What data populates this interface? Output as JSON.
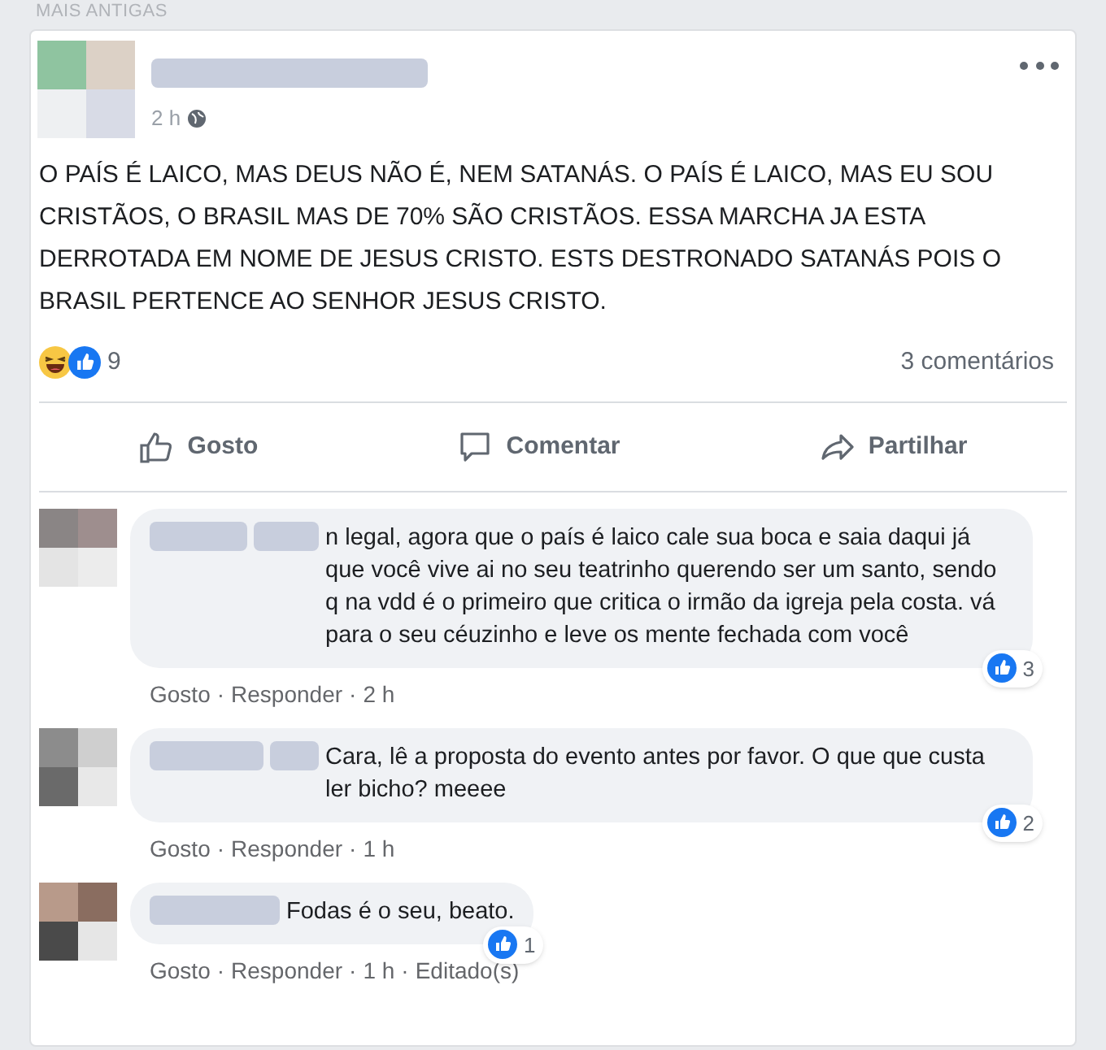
{
  "section_label": "MAIS ANTIGAS",
  "post": {
    "time": "2 h",
    "text": "O PAÍS É LAICO, MAS DEUS NÃO É, NEM SATANÁS. O PAÍS É LAICO, MAS EU SOU CRISTÃOS, O BRASIL MAS DE 70% SÃO CRISTÃOS. ESSA MARCHA JA ESTA DERROTADA EM NOME DE JESUS CRISTO. ESTS DESTRONADO SATANÁS POIS O BRASIL PERTENCE AO SENHOR JESUS CRISTO.",
    "reaction_count": "9",
    "comment_count": "3 comentários",
    "actions": [
      {
        "kind": "like",
        "label": "Gosto"
      },
      {
        "kind": "comment",
        "label": "Comentar"
      },
      {
        "kind": "share",
        "label": "Partilhar"
      }
    ]
  },
  "separator": "·",
  "comments": [
    {
      "text": "n legal, agora que o país é laico cale sua boca e saia daqui já que você vive ai no seu teatrinho querendo ser um santo, sendo q na vdd é o primeiro que critica o irmão da igreja pela costa. vá para o seu céuzinho e leve os mente fechada com você",
      "likes": "3",
      "links": [
        "Gosto",
        "Responder"
      ],
      "meta": [
        "2 h"
      ]
    },
    {
      "text": "Cara, lê a proposta do evento antes por favor. O que que custa ler bicho? meeee",
      "likes": "2",
      "links": [
        "Gosto",
        "Responder"
      ],
      "meta": [
        "1 h"
      ]
    },
    {
      "text": "Fodas é o seu, beato.",
      "likes": "1",
      "links": [
        "Gosto",
        "Responder"
      ],
      "meta": [
        "1 h",
        "Editado(s)"
      ]
    }
  ]
}
